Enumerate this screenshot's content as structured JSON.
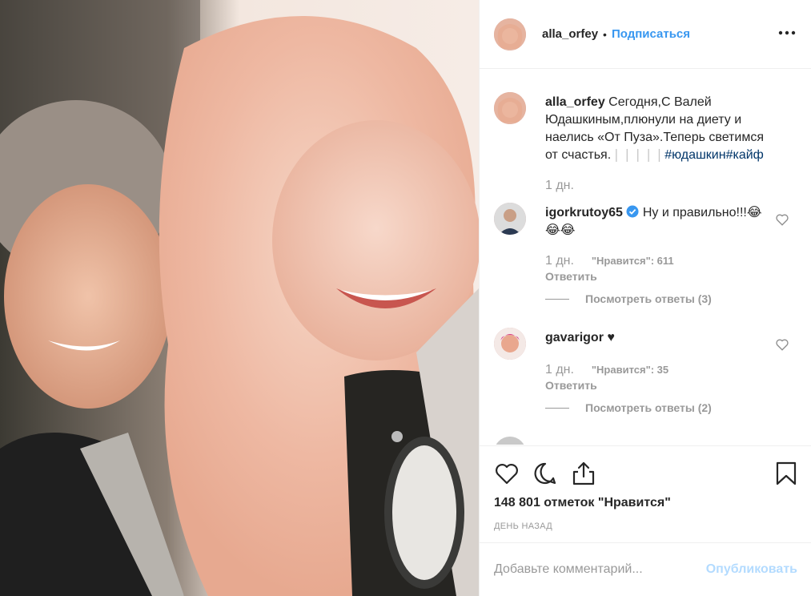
{
  "photo": {
    "alt": "",
    "icon": "selfie-photo"
  },
  "header": {
    "username": "alla_orfey",
    "separator": "•",
    "follow_label": "Подписаться",
    "more_icon": "more-dots-icon"
  },
  "caption": {
    "username": "alla_orfey",
    "text": "Сегодня,С Валей Юдашкиным,плюнули на диету и наелись «От Пуза».Теперь светимся от счастья.",
    "hidden_chars": "❘❘❘❘❘",
    "hashtags": "#юдашкин#кайф",
    "time": "1 дн."
  },
  "comments": [
    {
      "username": "igorkrutoy65",
      "verified": true,
      "text": "Ну и правильно!!!😂😂😂",
      "time": "1 дн.",
      "likes": "\"Нравится\": 611",
      "reply_label": "Ответить",
      "view_replies": "Посмотреть ответы (3)"
    },
    {
      "username": "gavarigor",
      "verified": false,
      "text": "♥",
      "time": "1 дн.",
      "likes": "\"Нравится\": 35",
      "reply_label": "Ответить",
      "view_replies": "Посмотреть ответы (2)"
    }
  ],
  "actions": {
    "like_icon": "heart-icon",
    "comment_icon": "comment-icon",
    "share_icon": "share-icon",
    "save_icon": "bookmark-icon",
    "likes_count": "148 801 отметок \"Нравится\"",
    "date": "ДЕНЬ НАЗАД"
  },
  "add_comment": {
    "placeholder": "Добавьте комментарий...",
    "publish_label": "Опубликовать"
  },
  "colors": {
    "link": "#3897f0",
    "hashtag": "#003569",
    "muted": "#999999",
    "publish_disabled": "#b3dbff",
    "border": "#efefef"
  }
}
